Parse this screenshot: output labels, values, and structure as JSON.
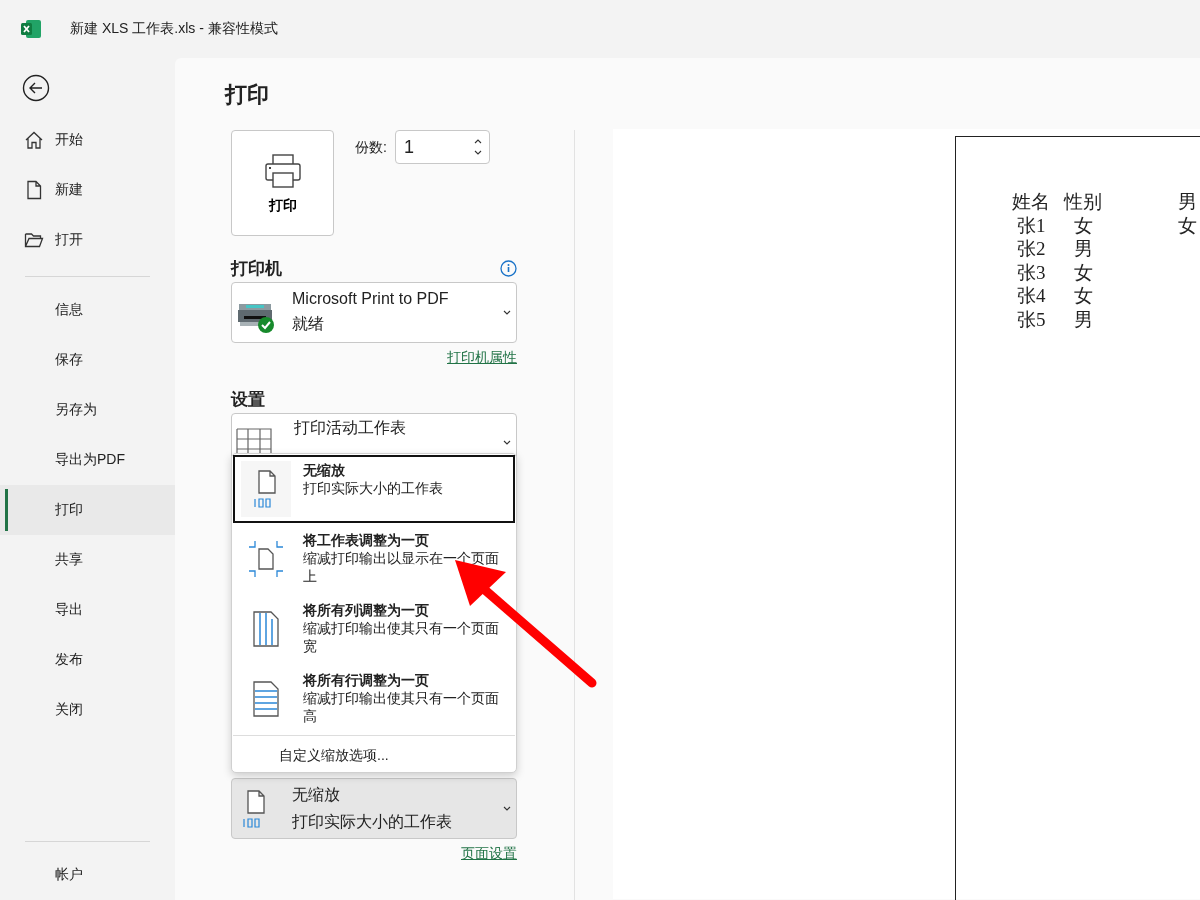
{
  "window": {
    "title": "新建 XLS 工作表.xls  -  兼容性模式"
  },
  "sidebar": {
    "top_items": [
      {
        "label": "开始"
      },
      {
        "label": "新建"
      },
      {
        "label": "打开"
      }
    ],
    "items": [
      {
        "label": "信息",
        "selected": false
      },
      {
        "label": "保存",
        "selected": false
      },
      {
        "label": "另存为",
        "selected": false
      },
      {
        "label": "导出为PDF",
        "selected": false
      },
      {
        "label": "打印",
        "selected": true
      },
      {
        "label": "共享",
        "selected": false
      },
      {
        "label": "导出",
        "selected": false
      },
      {
        "label": "发布",
        "selected": false
      },
      {
        "label": "关闭",
        "selected": false
      }
    ],
    "bottom_item": {
      "label": "帐户"
    }
  },
  "print": {
    "heading": "打印",
    "print_button": "打印",
    "copies_label": "份数:",
    "copies_value": "1",
    "printer_heading": "打印机",
    "printer_name": "Microsoft Print to PDF",
    "printer_status": "就绪",
    "printer_properties_link": "打印机属性",
    "settings_heading": "设置",
    "settings_select": "打印活动工作表",
    "scaling_options": [
      {
        "kind": "no-scale",
        "title": "无缩放",
        "description": "打印实际大小的工作表",
        "selected": true
      },
      {
        "kind": "fit-sheet",
        "title": "将工作表调整为一页",
        "description": "缩减打印输出以显示在一个页面上",
        "selected": false
      },
      {
        "kind": "fit-columns",
        "title": "将所有列调整为一页",
        "description": "缩减打印输出使其只有一个页面宽",
        "selected": false
      },
      {
        "kind": "fit-rows",
        "title": "将所有行调整为一页",
        "description": "缩减打印输出使其只有一个页面高",
        "selected": false
      }
    ],
    "custom_scaling": "自定义缩放选项...",
    "scaling_select": {
      "title": "无缩放",
      "description": "打印实际大小的工作表"
    },
    "page_setup_link": "页面设置"
  },
  "preview": {
    "rows": [
      [
        "姓名",
        "性别",
        "男"
      ],
      [
        "张1",
        "女",
        "女"
      ],
      [
        "张2",
        "男"
      ],
      [
        "张3",
        "女"
      ],
      [
        "张4",
        "女"
      ],
      [
        "张5",
        "男"
      ]
    ]
  }
}
